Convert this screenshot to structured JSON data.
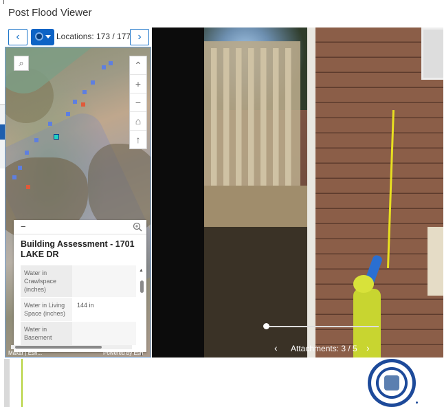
{
  "app": {
    "title": "Post Flood Viewer"
  },
  "nav": {
    "prev_icon": "‹",
    "next_icon": "›",
    "locations_label": "Locations: 173 / 177"
  },
  "map": {
    "search_icon": "⌕",
    "expand_icon": "⌃",
    "zoom_in": "+",
    "zoom_out": "−",
    "home_icon": "⌂",
    "north_icon": "↑",
    "attribution": "Maxar | Esri...",
    "powered_by": "Powered by Esri"
  },
  "popup": {
    "collapse_label": "−",
    "title": "Building Assessment - 1701 LAKE DR",
    "rows": [
      {
        "key": "Water in Crawlspace (inches)",
        "value": ""
      },
      {
        "key": "Water in Living Space (inches)",
        "value": "144 in"
      },
      {
        "key": "Water in Basement",
        "value": ""
      }
    ]
  },
  "viewer": {
    "prev_icon": "‹",
    "next_icon": "›",
    "attachments_label": "Attachments: 3 / 5",
    "slider_position": 0.0
  },
  "colors": {
    "accent": "#1b74c9",
    "map_point": "#5e7fe0",
    "selected_point": "#21d3c4",
    "alert_point": "#e05a3a",
    "seal": "#1d4a9a"
  }
}
